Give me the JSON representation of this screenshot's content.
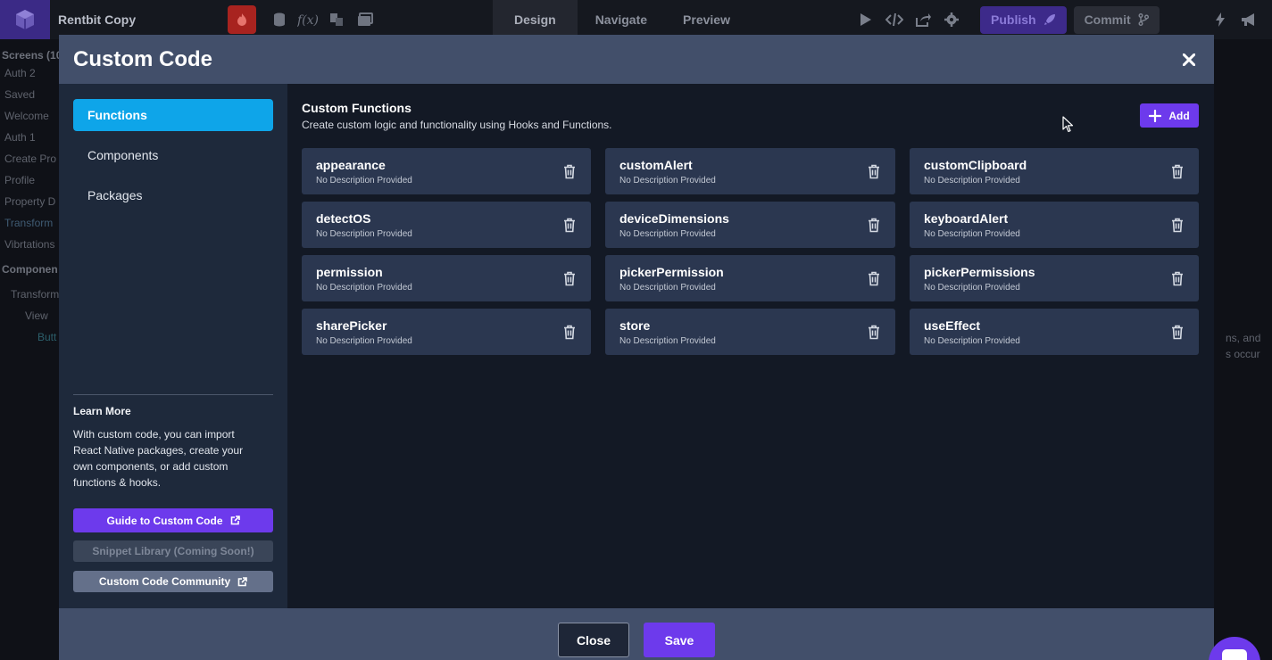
{
  "app": {
    "title": "Rentbit Copy",
    "tabs": [
      "Design",
      "Navigate",
      "Preview"
    ],
    "publish_label": "Publish",
    "commit_label": "Commit",
    "accent": "#6d3aec"
  },
  "background_sidebar": {
    "screens_header": "Screens (10",
    "screens": [
      "Auth 2",
      "Saved",
      "Welcome",
      "Auth 1",
      "Create Pro",
      "Profile",
      "Property D",
      "Transform",
      "Vibrtations"
    ],
    "components_header": "Componen",
    "tree": [
      "Transform",
      "View",
      "Butt"
    ]
  },
  "background_right": {
    "text_line_1": "ns, and",
    "text_line_2": "s occur"
  },
  "modal": {
    "title": "Custom Code",
    "nav": [
      "Functions",
      "Components",
      "Packages"
    ],
    "active_nav": "Functions",
    "learn_more_title": "Learn More",
    "learn_more_body": "With custom code, you can import React Native packages, create your own components, or add custom functions & hooks.",
    "guide_label": "Guide to Custom Code",
    "snippet_label": "Snippet Library (Coming Soon!)",
    "community_label": "Custom Code Community",
    "main_title": "Custom Functions",
    "main_subtitle": "Create custom logic and functionality using Hooks and Functions.",
    "add_label": "Add",
    "functions": [
      {
        "name": "appearance",
        "description": "No Description Provided"
      },
      {
        "name": "customAlert",
        "description": "No Description Provided"
      },
      {
        "name": "customClipboard",
        "description": "No Description Provided"
      },
      {
        "name": "detectOS",
        "description": "No Description Provided"
      },
      {
        "name": "deviceDimensions",
        "description": "No Description Provided"
      },
      {
        "name": "keyboardAlert",
        "description": "No Description Provided"
      },
      {
        "name": "permission",
        "description": "No Description Provided"
      },
      {
        "name": "pickerPermission",
        "description": "No Description Provided"
      },
      {
        "name": "pickerPermissions",
        "description": "No Description Provided"
      },
      {
        "name": "sharePicker",
        "description": "No Description Provided"
      },
      {
        "name": "store",
        "description": "No Description Provided"
      },
      {
        "name": "useEffect",
        "description": "No Description Provided"
      }
    ],
    "close_label": "Close",
    "save_label": "Save"
  }
}
